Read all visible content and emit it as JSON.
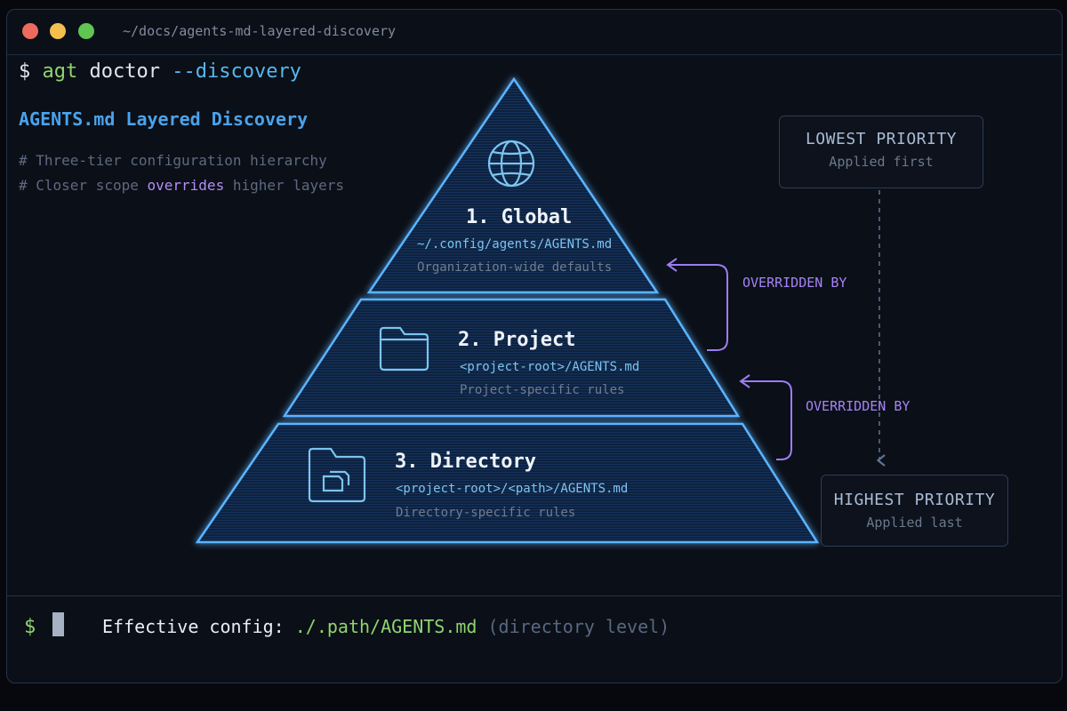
{
  "window": {
    "path": "~/docs/agents-md-layered-discovery"
  },
  "command": {
    "prompt": "$",
    "program": "agt",
    "subcommand": "doctor",
    "flag": "--discovery"
  },
  "intro": {
    "heading": "AGENTS.md Layered Discovery",
    "comment1": "# Three-tier configuration hierarchy",
    "comment2_prefix": "# Closer scope ",
    "comment2_highlight": "overrides",
    "comment2_suffix": " higher layers"
  },
  "tiers": [
    {
      "title": "1. Global",
      "path": "~/.config/agents/AGENTS.md",
      "desc": "Organization-wide defaults",
      "icon": "globe-icon"
    },
    {
      "title": "2. Project",
      "path": "<project-root>/AGENTS.md",
      "desc": "Project-specific rules",
      "icon": "folder-icon"
    },
    {
      "title": "3. Directory",
      "path": "<project-root>/<path>/AGENTS.md",
      "desc": "Directory-specific rules",
      "icon": "folder-file-icon"
    }
  ],
  "overrides": [
    {
      "label": "OVERRIDDEN BY"
    },
    {
      "label": "OVERRIDDEN BY"
    }
  ],
  "priority": {
    "lowest": {
      "title": "LOWEST PRIORITY",
      "sub": "Applied first"
    },
    "highest": {
      "title": "HIGHEST PRIORITY",
      "sub": "Applied last"
    }
  },
  "footer": {
    "prompt": "$",
    "label": "Effective config: ",
    "path": "./.path/AGENTS.md",
    "note": " (directory level)"
  },
  "colors": {
    "accent_blue": "#4aa3ec",
    "accent_green": "#8fd46f",
    "accent_purple": "#a583f5",
    "pyramid_edge": "#5ab4ff"
  }
}
